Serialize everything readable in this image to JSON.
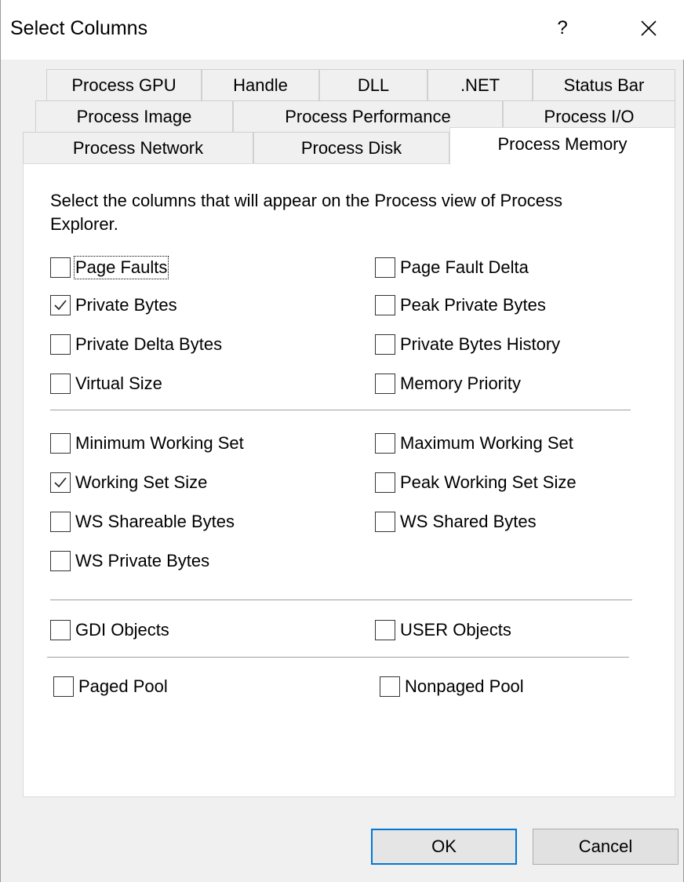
{
  "window": {
    "title": "Select Columns",
    "help_label": "?"
  },
  "tabs": {
    "row1": [
      "Process GPU",
      "Handle",
      "DLL",
      ".NET",
      "Status Bar"
    ],
    "row2": [
      "Process Image",
      "Process Performance",
      "Process I/O"
    ],
    "row3": [
      "Process Network",
      "Process Disk",
      "Process Memory"
    ],
    "active": "Process Memory"
  },
  "panel": {
    "description": "Select the columns that will appear on the Process view of Process Explorer.",
    "checkboxes": [
      {
        "label": "Page Faults",
        "checked": false
      },
      {
        "label": "Page Fault Delta",
        "checked": false
      },
      {
        "label": "Private Bytes",
        "checked": true
      },
      {
        "label": "Peak Private Bytes",
        "checked": false
      },
      {
        "label": "Private Delta Bytes",
        "checked": false
      },
      {
        "label": "Private Bytes History",
        "checked": false
      },
      {
        "label": "Virtual Size",
        "checked": false
      },
      {
        "label": "Memory Priority",
        "checked": false
      },
      {
        "label": "Minimum Working Set",
        "checked": false
      },
      {
        "label": "Maximum Working Set",
        "checked": false
      },
      {
        "label": "Working Set Size",
        "checked": true
      },
      {
        "label": "Peak Working Set Size",
        "checked": false
      },
      {
        "label": "WS Shareable Bytes",
        "checked": false
      },
      {
        "label": "WS Shared Bytes",
        "checked": false
      },
      {
        "label": "WS Private Bytes",
        "checked": false
      },
      {
        "label": "GDI Objects",
        "checked": false
      },
      {
        "label": "USER Objects",
        "checked": false
      },
      {
        "label": "Paged Pool",
        "checked": false
      },
      {
        "label": "Nonpaged Pool",
        "checked": false
      }
    ]
  },
  "buttons": {
    "ok": "OK",
    "cancel": "Cancel"
  },
  "colors": {
    "accent": "#0078d7",
    "panel_bg": "#ffffff",
    "dialog_bg": "#f0f0f0"
  }
}
